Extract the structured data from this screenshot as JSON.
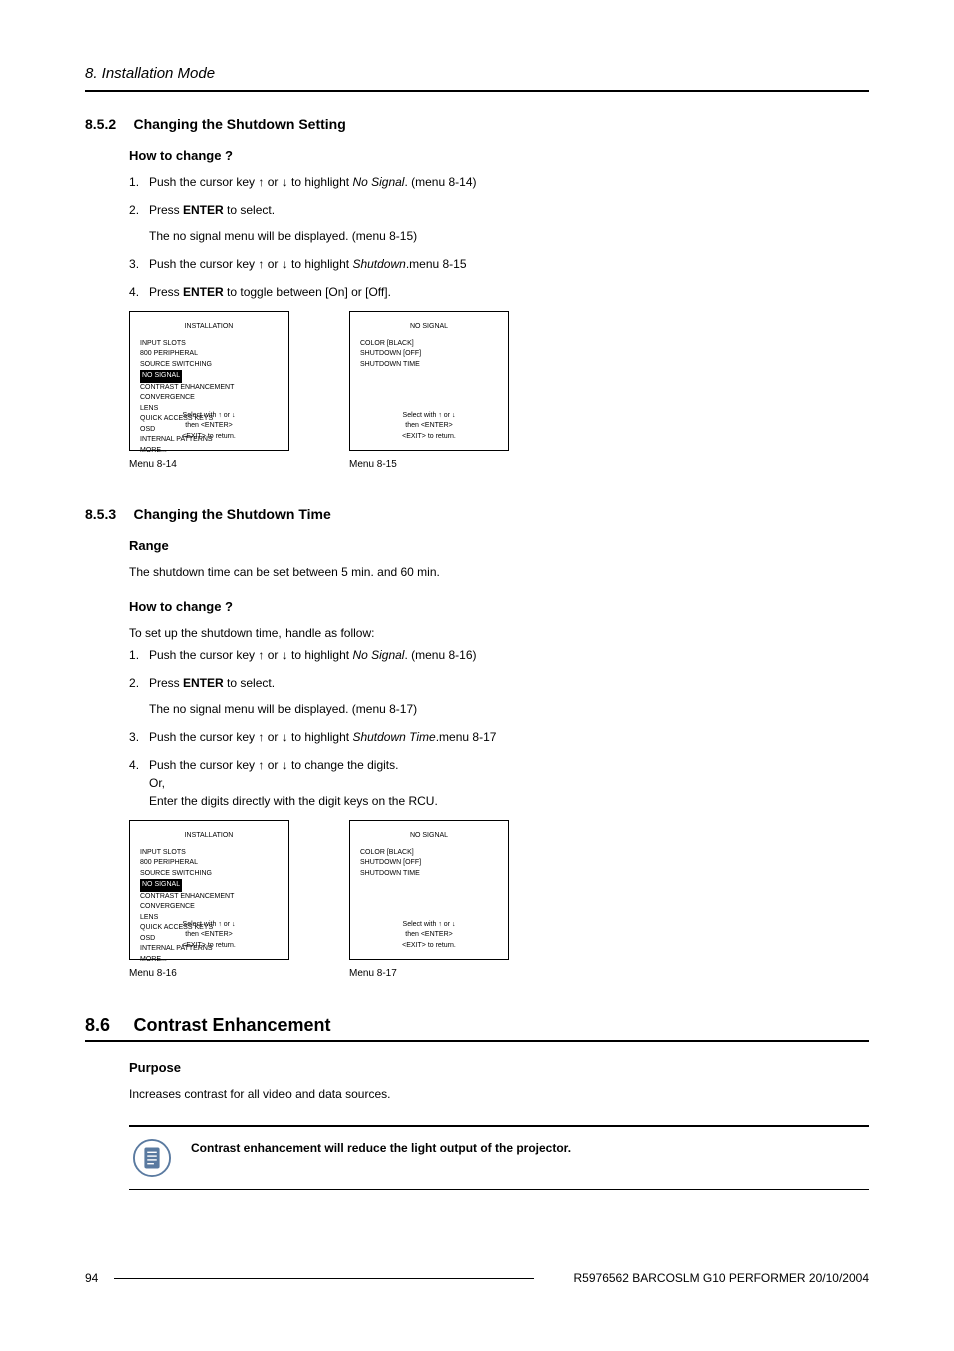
{
  "chapter": "8.  Installation Mode",
  "sections": {
    "s852": {
      "num": "8.5.2",
      "title": "Changing the Shutdown Setting",
      "howto_heading": "How to change ?",
      "steps": {
        "s1_a": "Push the cursor key ↑ or ↓ to highlight ",
        "s1_em": "No Signal",
        "s1_b": ".  (menu 8-14)",
        "s2_a": "Press ",
        "s2_b": "ENTER",
        "s2_c": " to select.",
        "s2_sub": "The no signal menu will be displayed.  (menu 8-15)",
        "s3_a": "Push the cursor key ↑ or ↓ to highlight ",
        "s3_em": "Shutdown",
        "s3_b": ".menu 8-15",
        "s4_a": "Press ",
        "s4_b": "ENTER",
        "s4_c": " to toggle between [On] or [Off]."
      },
      "menu14": {
        "title": "INSTALLATION",
        "items": [
          "INPUT SLOTS",
          "800 PERIPHERAL",
          "SOURCE SWITCHING",
          "NO SIGNAL",
          "CONTRAST ENHANCEMENT",
          "CONVERGENCE",
          "LENS",
          "QUICK ACCESS KEYS",
          "OSD",
          "INTERNAL PATTERNS",
          "MORE..."
        ],
        "highlight": 3,
        "footer": "Select with ↑ or ↓\nthen <ENTER>\n<EXIT> to return.",
        "caption": "Menu 8-14"
      },
      "menu15": {
        "title": "NO SIGNAL",
        "items": [
          "COLOR [BLACK]",
          "SHUTDOWN [OFF]",
          "SHUTDOWN TIME"
        ],
        "footer": "Select with ↑ or ↓\nthen <ENTER>\n<EXIT> to return.",
        "caption": "Menu 8-15"
      }
    },
    "s853": {
      "num": "8.5.3",
      "title": "Changing the Shutdown Time",
      "range_heading": "Range",
      "range_text": "The shutdown time can be set between 5 min.  and 60 min.",
      "howto_heading": "How to change ?",
      "intro": "To set up the shutdown time, handle as follow:",
      "steps": {
        "s1_a": "Push the cursor key ↑ or ↓ to highlight ",
        "s1_em": "No Signal",
        "s1_b": ".  (menu 8-16)",
        "s2_a": "Press ",
        "s2_b": "ENTER",
        "s2_c": " to select.",
        "s2_sub": "The no signal menu will be displayed.  (menu 8-17)",
        "s3_a": "Push the cursor key ↑ or ↓ to highlight ",
        "s3_em": "Shutdown Time",
        "s3_b": ".menu 8-17",
        "s4_a": "Push the cursor key ↑ or ↓ to change the digits.",
        "s4_or": "Or,",
        "s4_b": "Enter the digits directly with the digit keys on the RCU."
      },
      "menu16": {
        "title": "INSTALLATION",
        "items": [
          "INPUT SLOTS",
          "800 PERIPHERAL",
          "SOURCE SWITCHING",
          "NO SIGNAL",
          "CONTRAST ENHANCEMENT",
          "CONVERGENCE",
          "LENS",
          "QUICK ACCESS KEYS",
          "OSD",
          "INTERNAL PATTERNS",
          "MORE..."
        ],
        "highlight": 3,
        "footer": "Select with ↑ or ↓\nthen <ENTER>\n<EXIT> to return.",
        "caption": "Menu 8-16"
      },
      "menu17": {
        "title": "NO SIGNAL",
        "items": [
          "COLOR [BLACK]",
          "SHUTDOWN [OFF]",
          "SHUTDOWN TIME"
        ],
        "footer": "Select with ↑ or ↓\nthen <ENTER>\n<EXIT> to return.",
        "caption": "Menu 8-17"
      }
    },
    "s86": {
      "num": "8.6",
      "title": "Contrast Enhancement",
      "purpose_heading": "Purpose",
      "purpose_text": "Increases contrast for all video and data sources.",
      "note": "Contrast enhancement will reduce the light output of the projector."
    }
  },
  "footer": {
    "page": "94",
    "doc": "R5976562  BARCOSLM G10 PERFORMER  20/10/2004"
  }
}
